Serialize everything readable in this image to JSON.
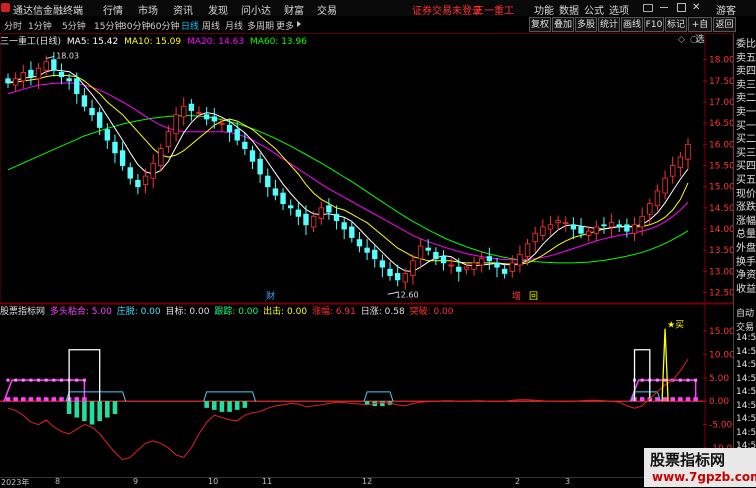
{
  "menubar": {
    "app_title": "通达信金融终端",
    "menus": [
      "行情",
      "市场",
      "资讯",
      "发现",
      "问小达",
      "财富",
      "交易"
    ],
    "login_notice": "证券交易未登录",
    "stock_name": "三一重工",
    "right_items": [
      "功能",
      "数据",
      "公式",
      "选项"
    ],
    "guest": "游客"
  },
  "toolbar": {
    "periods": [
      "分时",
      "1分钟",
      "5分钟",
      "15分钟",
      "30分钟",
      "60分钟",
      "日线",
      "周线",
      "月线",
      "多周期",
      "更多"
    ],
    "active_period": "日线",
    "buttons": [
      "复权",
      "叠加",
      "多股",
      "统计",
      "画线",
      "F10",
      "标记",
      "+自选",
      "返回"
    ]
  },
  "main_info": {
    "stock_title": "三一重工(日线)",
    "ma5": "MA5: 15.42",
    "ma10": "MA10: 15.09",
    "ma20": "MA20: 14.63",
    "ma60": "MA60: 13.96",
    "high_label": "18.03",
    "low_label": "12.60",
    "marker_cai": "财",
    "marker_zeng": "增",
    "marker_hui": "回",
    "colors": {
      "ma5": "#ffffff",
      "ma10": "#ffff00",
      "ma20": "#ff00ff",
      "ma60": "#00ff00",
      "up": "#ff3232",
      "down": "#54ffff"
    }
  },
  "price_axis": [
    "18.00",
    "17.50",
    "17.00",
    "16.50",
    "16.00",
    "15.50",
    "15.00",
    "14.50",
    "14.00",
    "13.50",
    "13.00",
    "12.50"
  ],
  "indicator_info": {
    "name": "股票指标网",
    "duotou": "多头粘合: 5.00",
    "zhuangtuo": "庄脱: 0.00",
    "mubiao": "目标: 0.00",
    "genzong": "跟踪: 0.00",
    "chuhuo": "出击: 0.00",
    "zhangfu": "涨幅: 6.91",
    "rizhang": "日涨: 0.58",
    "tupo": "突破: 0.00",
    "buy_signal": "买"
  },
  "indicator_axis": [
    "15.00",
    "10.00",
    "5.00",
    "0.00",
    "-5.00",
    "-10.00",
    "-15.00"
  ],
  "right_panel": {
    "upper": [
      "委比",
      "卖五",
      "卖四",
      "卖三",
      "卖二",
      "卖一",
      "买一",
      "买二",
      "买三",
      "买四",
      "买五",
      "现价",
      "涨跌",
      "涨幅",
      "总量",
      "外盘",
      "换手",
      "净资",
      "收益"
    ],
    "lower": [
      "自动",
      "交易",
      "14:50",
      "14:50",
      "14:50",
      "14:50",
      "14:50",
      "14:50",
      "14:50",
      "14:50",
      "14:50",
      "14:50"
    ]
  },
  "bottom_axis": [
    "2023年",
    "8",
    "9",
    "10",
    "11",
    "12",
    "2",
    "3"
  ],
  "watermark": {
    "line1": "股票指标网",
    "line2": "www.7gpzb.com"
  },
  "chart_data": {
    "type": "candlestick",
    "title": "三一重工(日线)",
    "y_range": [
      12.3,
      18.3
    ],
    "high_marker": 18.03,
    "low_marker": 12.6,
    "close": [
      17.45,
      17.55,
      17.7,
      17.6,
      17.8,
      17.95,
      17.75,
      17.6,
      17.5,
      17.2,
      16.9,
      16.7,
      16.4,
      16.1,
      15.8,
      15.5,
      15.2,
      15.0,
      15.25,
      15.55,
      15.9,
      16.3,
      16.7,
      16.9,
      16.8,
      16.75,
      16.6,
      16.55,
      16.5,
      16.3,
      16.1,
      15.9,
      15.6,
      15.3,
      15.0,
      14.8,
      14.6,
      14.5,
      14.3,
      14.1,
      14.3,
      14.5,
      14.4,
      14.2,
      14.0,
      13.8,
      13.6,
      13.45,
      13.3,
      13.1,
      12.9,
      12.8,
      12.95,
      13.25,
      13.6,
      13.5,
      13.3,
      13.2,
      13.15,
      13.0,
      13.1,
      13.2,
      13.3,
      13.25,
      13.1,
      12.95,
      13.2,
      13.4,
      13.65,
      13.9,
      14.05,
      14.1,
      14.2,
      14.15,
      14.0,
      13.9,
      13.95,
      14.05,
      14.1,
      14.15,
      14.05,
      13.95,
      14.1,
      14.3,
      14.6,
      14.9,
      15.2,
      15.5,
      15.7,
      16.0
    ],
    "ma5": [
      17.45,
      17.5,
      17.57,
      17.58,
      17.62,
      17.72,
      17.76,
      17.74,
      17.72,
      17.6,
      17.39,
      17.18,
      16.94,
      16.66,
      16.38,
      16.1,
      15.8,
      15.52,
      15.35,
      15.3,
      15.38,
      15.6,
      15.94,
      16.27,
      16.52,
      16.69,
      16.75,
      16.72,
      16.64,
      16.54,
      16.41,
      16.27,
      16.08,
      15.84,
      15.58,
      15.32,
      15.06,
      14.84,
      14.64,
      14.46,
      14.36,
      14.34,
      14.36,
      14.32,
      14.28,
      14.18,
      14.0,
      13.81,
      13.63,
      13.45,
      13.27,
      13.11,
      13.01,
      13.0,
      13.1,
      13.22,
      13.32,
      13.37,
      13.35,
      13.23,
      13.15,
      13.13,
      13.15,
      13.17,
      13.19,
      13.16,
      13.16,
      13.18,
      13.26,
      13.42,
      13.64,
      13.82,
      13.98,
      14.08,
      14.1,
      14.07,
      14.04,
      14.01,
      14.0,
      14.03,
      14.06,
      14.06,
      14.07,
      14.11,
      14.22,
      14.38,
      14.62,
      14.9,
      15.18,
      15.42
    ],
    "ma10": [
      17.45,
      17.47,
      17.5,
      17.52,
      17.55,
      17.6,
      17.63,
      17.63,
      17.62,
      17.6,
      17.5,
      17.35,
      17.2,
      17.0,
      16.85,
      16.7,
      16.5,
      16.3,
      16.1,
      15.9,
      15.75,
      15.7,
      15.75,
      15.85,
      16.0,
      16.15,
      16.3,
      16.45,
      16.55,
      16.6,
      16.55,
      16.45,
      16.35,
      16.2,
      16.05,
      15.9,
      15.7,
      15.5,
      15.3,
      15.05,
      14.85,
      14.7,
      14.6,
      14.5,
      14.45,
      14.35,
      14.25,
      14.15,
      14.0,
      13.85,
      13.7,
      13.55,
      13.45,
      13.35,
      13.3,
      13.25,
      13.25,
      13.25,
      13.25,
      13.22,
      13.2,
      13.2,
      13.2,
      13.2,
      13.2,
      13.18,
      13.17,
      13.17,
      13.2,
      13.28,
      13.38,
      13.5,
      13.62,
      13.72,
      13.8,
      13.85,
      13.9,
      13.95,
      14.0,
      14.03,
      14.05,
      14.05,
      14.05,
      14.06,
      14.1,
      14.17,
      14.28,
      14.45,
      14.7,
      15.09
    ],
    "ma20": [
      17.2,
      17.25,
      17.3,
      17.35,
      17.4,
      17.42,
      17.44,
      17.45,
      17.45,
      17.44,
      17.4,
      17.35,
      17.28,
      17.2,
      17.1,
      17.0,
      16.9,
      16.78,
      16.66,
      16.55,
      16.45,
      16.38,
      16.33,
      16.3,
      16.3,
      16.3,
      16.3,
      16.3,
      16.3,
      16.28,
      16.24,
      16.18,
      16.1,
      16.0,
      15.9,
      15.78,
      15.66,
      15.54,
      15.42,
      15.3,
      15.18,
      15.06,
      14.95,
      14.85,
      14.75,
      14.65,
      14.55,
      14.45,
      14.35,
      14.25,
      14.15,
      14.05,
      13.95,
      13.85,
      13.77,
      13.7,
      13.64,
      13.58,
      13.52,
      13.47,
      13.42,
      13.38,
      13.35,
      13.32,
      13.3,
      13.28,
      13.27,
      13.27,
      13.28,
      13.3,
      13.33,
      13.37,
      13.42,
      13.48,
      13.54,
      13.6,
      13.66,
      13.72,
      13.77,
      13.81,
      13.85,
      13.88,
      13.91,
      13.95,
      14.0,
      14.07,
      14.17,
      14.3,
      14.45,
      14.63
    ],
    "ma60": [
      15.4,
      15.48,
      15.56,
      15.64,
      15.72,
      15.8,
      15.88,
      15.96,
      16.04,
      16.12,
      16.2,
      16.26,
      16.32,
      16.38,
      16.43,
      16.48,
      16.52,
      16.56,
      16.59,
      16.62,
      16.64,
      16.66,
      16.67,
      16.68,
      16.68,
      16.67,
      16.65,
      16.62,
      16.58,
      16.54,
      16.49,
      16.43,
      16.37,
      16.3,
      16.22,
      16.14,
      16.05,
      15.96,
      15.86,
      15.76,
      15.66,
      15.56,
      15.45,
      15.34,
      15.23,
      15.12,
      15.0,
      14.88,
      14.76,
      14.64,
      14.52,
      14.4,
      14.29,
      14.18,
      14.08,
      13.98,
      13.89,
      13.8,
      13.72,
      13.65,
      13.58,
      13.52,
      13.46,
      13.41,
      13.37,
      13.33,
      13.3,
      13.27,
      13.25,
      13.23,
      13.22,
      13.21,
      13.2,
      13.2,
      13.2,
      13.21,
      13.22,
      13.24,
      13.26,
      13.29,
      13.32,
      13.36,
      13.4,
      13.45,
      13.51,
      13.58,
      13.66,
      13.75,
      13.85,
      13.96
    ]
  },
  "indicator_chart": {
    "y_range": [
      -16,
      18
    ],
    "red_line": [
      -1.5,
      -2.0,
      -3.0,
      -4.5,
      -5.0,
      -4.0,
      -5.5,
      -6.5,
      -7.0,
      -6.0,
      -5.0,
      -5.5,
      -7.0,
      -9.0,
      -11.0,
      -12.5,
      -12.0,
      -10.5,
      -9.0,
      -8.5,
      -9.0,
      -10.0,
      -11.5,
      -12.0,
      -10.0,
      -7.0,
      -4.5,
      -3.0,
      -3.5,
      -4.0,
      -4.2,
      -3.0,
      -2.5,
      -2.2,
      -1.5,
      -1.0,
      -0.8,
      -0.5,
      -0.6,
      -1.2,
      -1.0,
      -0.8,
      -0.5,
      -0.2,
      -0.3,
      -0.5,
      -0.6,
      -0.8,
      -0.5,
      -0.3,
      -0.4,
      -0.8,
      -1.0,
      -0.5,
      -0.2,
      -0.1,
      0.0,
      0.1,
      0.1,
      0.0,
      0.0,
      0.1,
      0.1,
      0.0,
      -0.1,
      0.0,
      0.2,
      0.3,
      0.3,
      0.2,
      0.1,
      0.0,
      0.0,
      -0.1,
      0.0,
      0.1,
      0.2,
      0.2,
      0.1,
      0.0,
      -0.2,
      -1.0,
      -1.5,
      -1.0,
      0.5,
      2.0,
      3.5,
      4.5,
      6.5,
      9.0
    ],
    "magenta_bands": [
      [
        0,
        10
      ],
      [
        82,
        90
      ]
    ],
    "cyan_boxes": [
      [
        8,
        15
      ],
      [
        26,
        32
      ],
      [
        47,
        50
      ],
      [
        82,
        85
      ]
    ],
    "white_boxes": [
      [
        8,
        12
      ],
      [
        82,
        84
      ]
    ],
    "green_bars": [
      [
        8,
        14,
        -5.0
      ],
      [
        26,
        31,
        -2.5
      ],
      [
        47,
        50,
        -1.2
      ]
    ],
    "yellow_spike_index": 86,
    "buy_index": 86
  }
}
